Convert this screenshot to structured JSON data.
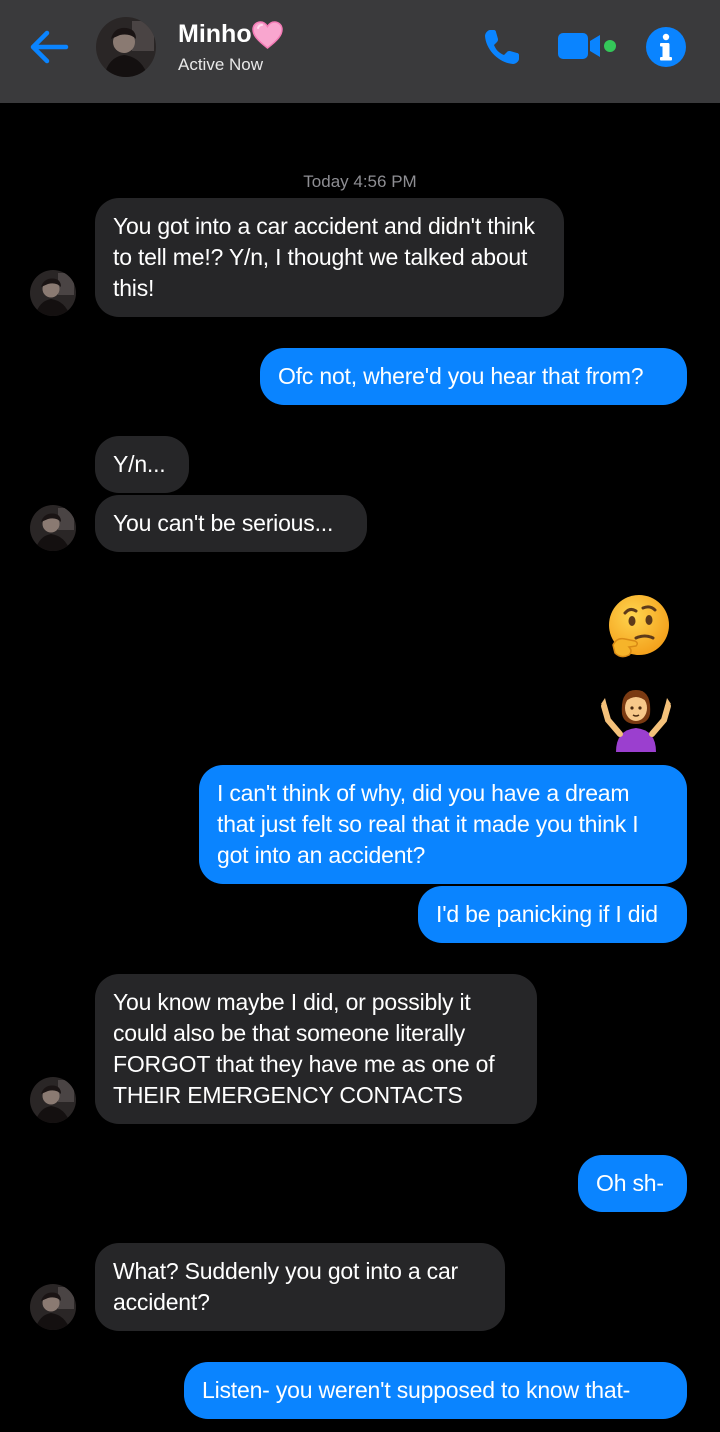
{
  "header": {
    "contact_name": "Minho",
    "status": "Active Now",
    "accent_color": "#0a84ff",
    "icons": [
      "back-arrow-icon",
      "heart-icon",
      "phone-icon",
      "video-camera-icon",
      "info-icon"
    ]
  },
  "conversation": {
    "timestamp": "Today 4:56 PM",
    "messages": [
      {
        "from": "them",
        "text": "You got into a car accident and didn't think to tell me!? Y/n, I thought we talked about this!"
      },
      {
        "from": "me",
        "text": "Ofc not, where'd you hear that from?"
      },
      {
        "from": "them",
        "text": "Y/n..."
      },
      {
        "from": "them",
        "text": "You can't be serious..."
      },
      {
        "from": "me",
        "emoji": "thinking-face"
      },
      {
        "from": "me",
        "emoji": "person-shrugging"
      },
      {
        "from": "me",
        "text": "I can't think of why, did you have a dream that just felt so real that it made you think I got into an accident?"
      },
      {
        "from": "me",
        "text": "I'd be panicking if I did"
      },
      {
        "from": "them",
        "text": "You know maybe I did, or possibly it could also be that someone literally FORGOT that they have me as one of THEIR EMERGENCY CONTACTS"
      },
      {
        "from": "me",
        "text": "Oh sh-"
      },
      {
        "from": "them",
        "text": "What? Suddenly you got into a car accident?"
      },
      {
        "from": "me",
        "text": "Listen- you weren't supposed to know that-"
      }
    ]
  }
}
